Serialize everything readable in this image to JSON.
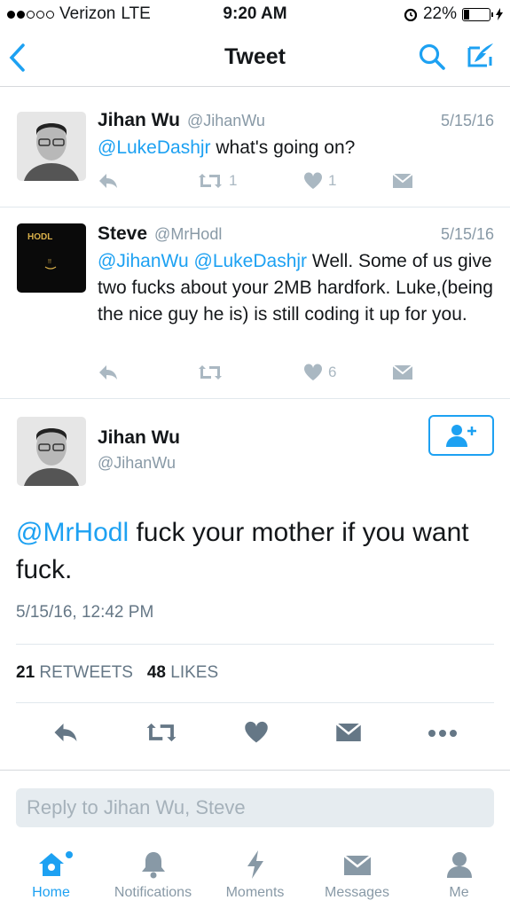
{
  "status_bar": {
    "carrier": "Verizon",
    "network": "LTE",
    "time": "9:20 AM",
    "battery": "22%"
  },
  "nav": {
    "title": "Tweet"
  },
  "tweets": [
    {
      "name": "Jihan Wu",
      "handle": "@JihanWu",
      "date": "5/15/16",
      "mention": "@LukeDashjr",
      "text": " what's going on?",
      "retweets": "1",
      "likes": "1"
    },
    {
      "name": "Steve",
      "handle": "@MrHodl",
      "date": "5/15/16",
      "avatar_text": "HODL",
      "mention1": "@JihanWu",
      "mention2": "@LukeDashjr",
      "text": " Well. Some of us give two fucks about your 2MB hardfork. Luke,(being the nice guy he is) is still coding it up for you.",
      "retweets": "",
      "likes": "6"
    }
  ],
  "main_tweet": {
    "name": "Jihan Wu",
    "handle": "@JihanWu",
    "mention": "@MrHodl",
    "text": " fuck your mother if you want fuck.",
    "timestamp": "5/15/16, 12:42 PM",
    "retweet_count": "21",
    "retweet_label": "RETWEETS",
    "like_count": "48",
    "like_label": "LIKES"
  },
  "reply": {
    "placeholder": "Reply to Jihan Wu, Steve"
  },
  "tabs": [
    {
      "label": "Home",
      "icon": "home-icon"
    },
    {
      "label": "Notifications",
      "icon": "bell-icon"
    },
    {
      "label": "Moments",
      "icon": "lightning-icon"
    },
    {
      "label": "Messages",
      "icon": "envelope-icon"
    },
    {
      "label": "Me",
      "icon": "person-icon"
    }
  ],
  "colors": {
    "accent": "#1da1f2",
    "muted": "#8899a6",
    "icon_grey": "#aab8c2"
  }
}
